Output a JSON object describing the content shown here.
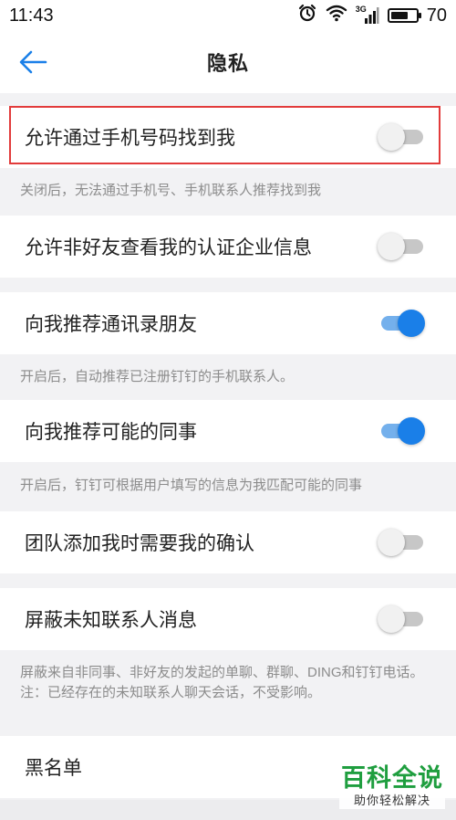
{
  "status_bar": {
    "time": "11:43",
    "network": "3G",
    "battery_level": "70",
    "battery_fraction": 0.7
  },
  "nav": {
    "title": "隐私",
    "back_icon": "arrow-left-icon"
  },
  "colors": {
    "accent": "#1a7fe8",
    "highlight": "#e23b3b",
    "watermark": "#1f9e3f"
  },
  "settings": [
    {
      "label": "允许通过手机号码找到我",
      "on": false,
      "note": "关闭后，无法通过手机号、手机联系人推荐找到我"
    },
    {
      "label": "允许非好友查看我的认证企业信息",
      "on": false,
      "note": ""
    },
    {
      "label": "向我推荐通讯录朋友",
      "on": true,
      "note": "开启后，自动推荐已注册钉钉的手机联系人。"
    },
    {
      "label": "向我推荐可能的同事",
      "on": true,
      "note": "开启后，钉钉可根据用户填写的信息为我匹配可能的同事"
    },
    {
      "label": "团队添加我时需要我的确认",
      "on": false,
      "note": ""
    },
    {
      "label": "屏蔽未知联系人消息",
      "on": false,
      "note": "屏蔽来自非同事、非好友的发起的单聊、群聊、DING和钉钉电话。注：已经存在的未知联系人聊天会话，不受影响。"
    }
  ],
  "blacklist": {
    "label": "黑名单"
  },
  "watermark": {
    "title": "百科全说",
    "subtitle": "助你轻松解决"
  }
}
